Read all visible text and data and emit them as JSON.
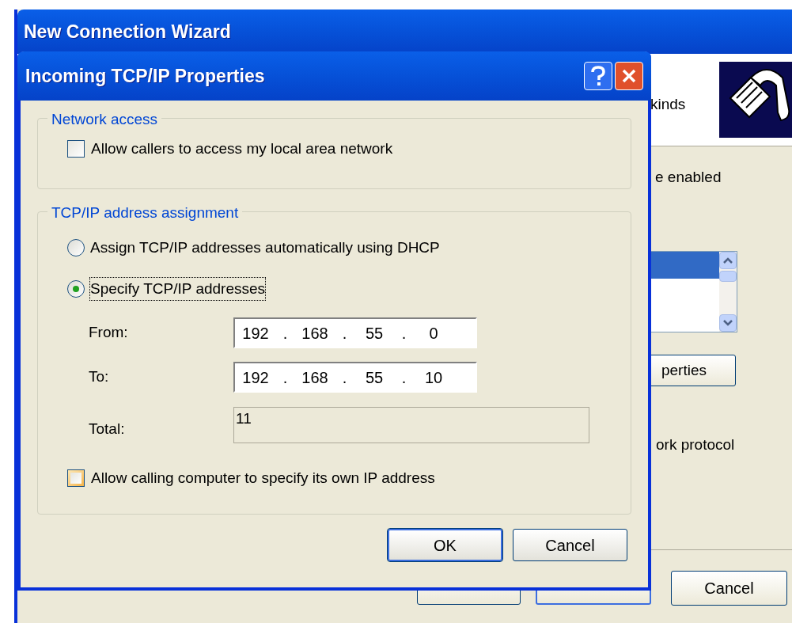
{
  "wizard": {
    "title": "New Connection Wizard",
    "header_text": "kinds",
    "body_texts": [
      "e enabled",
      "ork protocol"
    ],
    "list_rows": [
      {
        "selected": true
      }
    ],
    "properties_button": "perties",
    "cancel_button": "Cancel"
  },
  "dialog": {
    "title": "Incoming TCP/IP Properties",
    "network_access": {
      "label": "Network access",
      "checkbox": {
        "label": "Allow callers to access my local area network",
        "checked": false,
        "hovered": false
      }
    },
    "address_assignment": {
      "label": "TCP/IP address assignment",
      "options": [
        {
          "label": "Assign TCP/IP addresses automatically using DHCP",
          "selected": false,
          "focused": false
        },
        {
          "label": "Specify TCP/IP addresses",
          "selected": true,
          "focused": true
        }
      ],
      "from": {
        "label": "From:",
        "octets": [
          "192",
          "168",
          "55",
          "0"
        ],
        "separators": [
          ".",
          ".",
          "."
        ]
      },
      "to": {
        "label": "To:",
        "octets": [
          "192",
          "168",
          "55",
          "10"
        ],
        "separators": [
          ".",
          ".",
          "."
        ]
      },
      "total": {
        "label": "Total:",
        "value": "11",
        "disabled": true
      },
      "checkbox": {
        "label": "Allow calling computer to specify its own IP address",
        "checked": false,
        "hovered": true
      }
    },
    "buttons": [
      {
        "label": "OK",
        "default": true
      },
      {
        "label": "Cancel",
        "default": false
      }
    ]
  }
}
